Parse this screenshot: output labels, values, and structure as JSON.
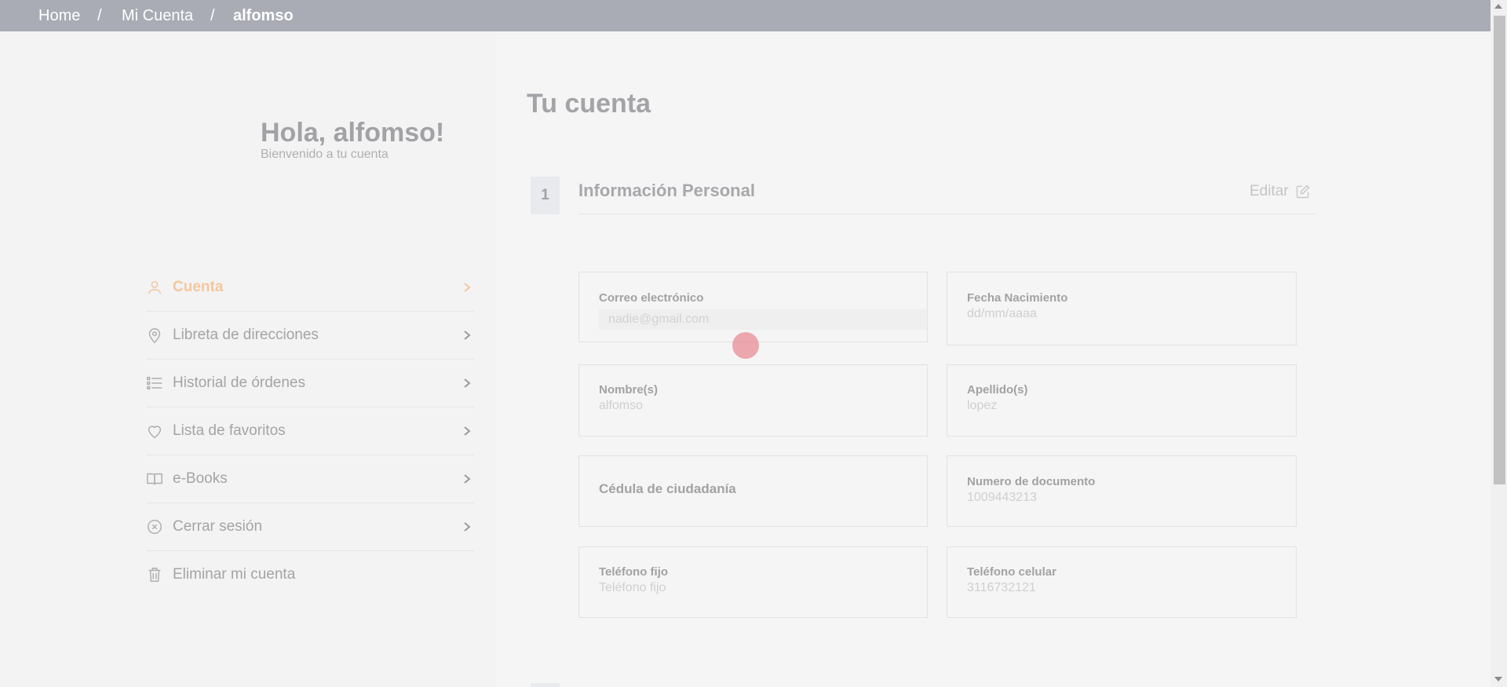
{
  "breadcrumb": {
    "home": "Home",
    "account": "Mi Cuenta",
    "current": "alfomso",
    "separator": "/"
  },
  "sidebar": {
    "greeting": "Hola, alfomso!",
    "subtitle": "Bienvenido a tu cuenta",
    "items": [
      {
        "label": "Cuenta",
        "icon": "user-icon",
        "active": true
      },
      {
        "label": "Libreta de direcciones",
        "icon": "map-pin-icon"
      },
      {
        "label": "Historial de órdenes",
        "icon": "list-icon"
      },
      {
        "label": "Lista de favoritos",
        "icon": "heart-icon"
      },
      {
        "label": "e-Books",
        "icon": "book-icon"
      },
      {
        "label": "Cerrar sesión",
        "icon": "close-circle-icon"
      },
      {
        "label": "Eliminar mi cuenta",
        "icon": "trash-icon"
      }
    ]
  },
  "main": {
    "title": "Tu cuenta",
    "section": {
      "number": "1",
      "title": "Información Personal",
      "edit_label": "Editar"
    },
    "fields": {
      "email": {
        "label": "Correo electrónico",
        "placeholder": "nadie@gmail.com"
      },
      "birthdate": {
        "label": "Fecha Nacimiento",
        "value": "dd/mm/aaaa"
      },
      "first_name": {
        "label": "Nombre(s)",
        "value": "alfomso"
      },
      "last_name": {
        "label": "Apellido(s)",
        "value": "lopez"
      },
      "document_type": {
        "label": "Cédula de ciudadanía"
      },
      "document_number": {
        "label": "Numero de documento",
        "value": "1009443213"
      },
      "landline": {
        "label": "Teléfono fijo",
        "value": "Teléfono fijo"
      },
      "mobile": {
        "label": "Teléfono celular",
        "value": "3116732121"
      }
    }
  },
  "colors": {
    "accent": "#f4c79e",
    "topbar": "#a9acb4",
    "cursor": "#e88c96"
  }
}
